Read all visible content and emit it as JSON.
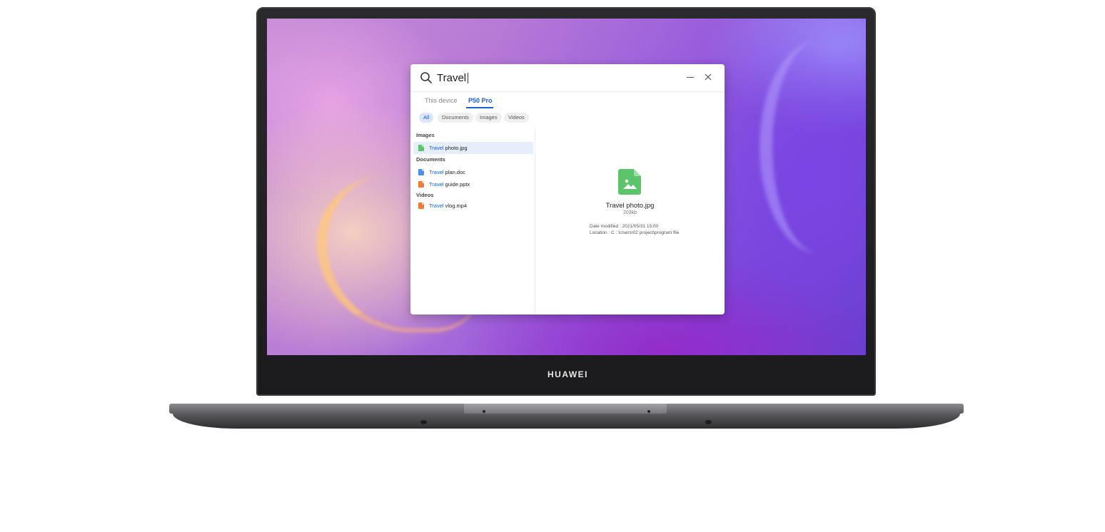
{
  "brand": "HUAWEI",
  "search": {
    "query": "Travel"
  },
  "tabs": [
    {
      "label": "This device",
      "active": false
    },
    {
      "label": "P50 Pro",
      "active": true
    }
  ],
  "filters": [
    {
      "label": "All",
      "active": true
    },
    {
      "label": "Documents",
      "active": false
    },
    {
      "label": "Images",
      "active": false
    },
    {
      "label": "Videos",
      "active": false
    }
  ],
  "results": {
    "images_label": "Images",
    "documents_label": "Documents",
    "videos_label": "Videos",
    "items": [
      {
        "match": "Travel",
        "rest": " photo.jpg",
        "icon": "image-file-icon",
        "color": "#5cc46a",
        "selected": true
      },
      {
        "match": "Travel",
        "rest": " plan.doc",
        "icon": "doc-file-icon",
        "color": "#4a8ef0",
        "selected": false
      },
      {
        "match": "Travel",
        "rest": " guide.pptx",
        "icon": "pptx-file-icon",
        "color": "#f07a3a",
        "selected": false
      },
      {
        "match": "Travel",
        "rest": " vlog.mp4",
        "icon": "video-file-icon",
        "color": "#f07a3a",
        "selected": false
      }
    ]
  },
  "preview": {
    "name": "Travel photo.jpg",
    "size": "203kb",
    "date_modified": "Date modified : 2021/05/31 15:00",
    "location": "Location : C : \\Users\\02 project\\program file",
    "icon": "image-file-icon",
    "icon_color": "#5cc46a"
  },
  "colors": {
    "accent": "#1a5fe0",
    "selected_row": "#e6eefc"
  }
}
